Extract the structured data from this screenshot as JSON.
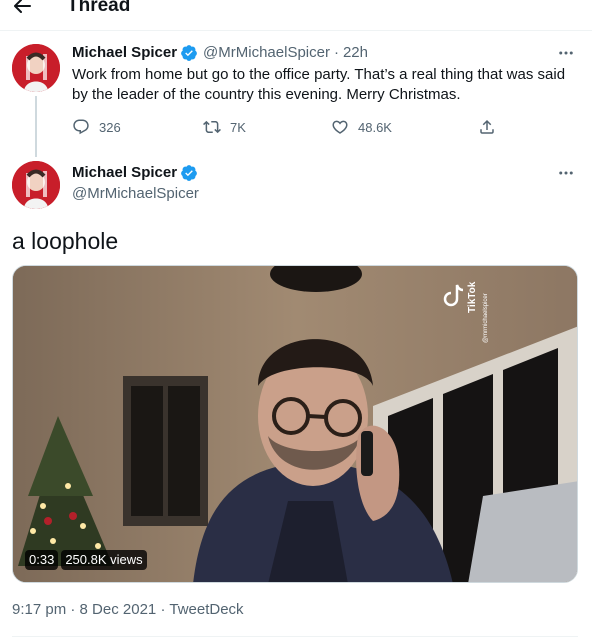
{
  "header": {
    "back_icon": "arrow-left-icon",
    "title": "Thread"
  },
  "tweet1": {
    "display_name": "Michael Spicer",
    "handle": "@MrMichaelSpicer",
    "separator": "·",
    "time": "22h",
    "text": "Work from home but go to the office party. That’s a real thing that was said by the leader of the country this evening. Merry Christmas.",
    "replies": "326",
    "retweets": "7K",
    "likes": "48.6K"
  },
  "tweet2": {
    "display_name": "Michael Spicer",
    "handle": "@MrMichaelSpicer",
    "text": "a loophole",
    "video": {
      "duration": "0:33",
      "views": "250.8K views",
      "watermark": "TikTok",
      "watermark_handle": "@mrmichaelspicer"
    },
    "timestamp": "9:17 pm",
    "date": "8 Dec 2021",
    "source": "TweetDeck",
    "separator": "·"
  },
  "colors": {
    "text_primary": "#0f1419",
    "text_secondary": "#536471",
    "verified_blue": "#1d9bf0",
    "divider": "#eff3f4"
  }
}
